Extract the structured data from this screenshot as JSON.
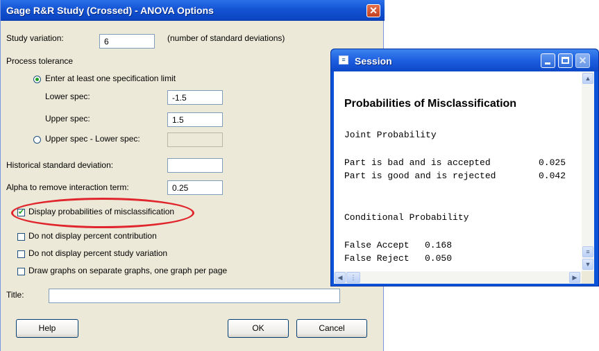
{
  "dialog": {
    "title": "Gage R&R Study (Crossed) - ANOVA Options",
    "study_variation": {
      "label": "Study variation:",
      "value": "6",
      "hint": "(number of standard deviations)"
    },
    "process_tolerance": {
      "label": "Process tolerance",
      "option_spec_limit": "Enter at least one specification limit",
      "lower_spec": {
        "label": "Lower spec:",
        "value": "-1.5"
      },
      "upper_spec": {
        "label": "Upper spec:",
        "value": "1.5"
      },
      "option_range": "Upper spec - Lower spec:",
      "selected_option": "spec_limit"
    },
    "historical_sd": {
      "label": "Historical standard deviation:",
      "value": ""
    },
    "alpha": {
      "label": "Alpha to remove interaction term:",
      "value": "0.25"
    },
    "checkboxes": [
      {
        "label": "Display probabilities of misclassification",
        "checked": true
      },
      {
        "label": "Do not display percent contribution",
        "checked": false
      },
      {
        "label": "Do not display percent study variation",
        "checked": false
      },
      {
        "label": "Draw graphs on separate graphs, one graph per page",
        "checked": false
      }
    ],
    "title_field": {
      "label": "Title:",
      "value": ""
    },
    "buttons": {
      "help": "Help",
      "ok": "OK",
      "cancel": "Cancel"
    },
    "close_icon": "close-icon",
    "highlight_color": "#e0262c"
  },
  "session": {
    "title": "Session",
    "heading": "Probabilities of Misclassification",
    "joint_label": "Joint Probability",
    "joint_rows": [
      {
        "label": "Part is bad and is accepted",
        "value": "0.025"
      },
      {
        "label": "Part is good and is rejected",
        "value": "0.042"
      }
    ],
    "conditional_label": "Conditional Probability",
    "conditional_rows": [
      {
        "label": "False Accept",
        "value": "0.168"
      },
      {
        "label": "False Reject",
        "value": "0.050"
      }
    ]
  }
}
